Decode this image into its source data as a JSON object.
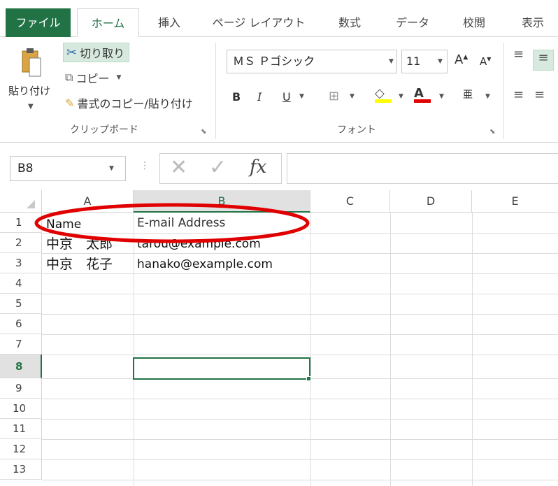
{
  "ribbon_tabs": [
    "ファイル",
    "ホーム",
    "挿入",
    "ページ レイアウト",
    "数式",
    "データ",
    "校閲",
    "表示"
  ],
  "clipboard": {
    "paste_label": "貼り付け",
    "cut_label": "切り取り",
    "copy_label": "コピー",
    "format_painter_label": "書式のコピー/貼り付け",
    "group_label": "クリップボード"
  },
  "font": {
    "name": "ＭＳ Ｐゴシック",
    "size": "11",
    "bold": "B",
    "italic": "I",
    "underline": "U",
    "group_label": "フォント"
  },
  "formula_bar": {
    "name_box": "B8",
    "fx_label": "fx",
    "formula": ""
  },
  "sheet": {
    "columns": [
      "A",
      "B",
      "C",
      "D",
      "E"
    ],
    "rows": [
      "1",
      "2",
      "3",
      "4",
      "5",
      "6",
      "7",
      "8",
      "9",
      "10",
      "11",
      "12",
      "13"
    ],
    "selected_cell": "B8",
    "cells": {
      "a1": "Name",
      "b1": "E-mail Address",
      "a2": "中京　太郎",
      "b2": "tarou@example.com",
      "a3": "中京　花子",
      "b3": "hanako@example.com"
    }
  },
  "colors": {
    "accent": "#217346",
    "annotation": "#e00000"
  }
}
